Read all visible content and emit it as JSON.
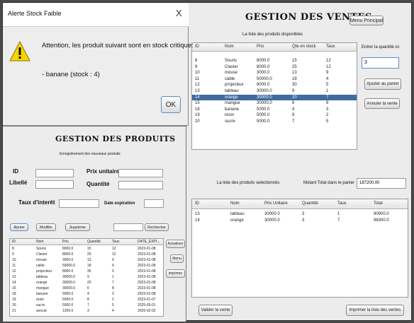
{
  "alert": {
    "title": "Alerte Stock Faible",
    "close": "X",
    "message": "Attention, les produit suivant sont en stock critique:",
    "item": "- banane (stock : 4)",
    "ok": "OK",
    "warning_color": "#f5d400"
  },
  "ventes": {
    "title": "GESTION DES VENTES",
    "menu_btn": "Menu Principal",
    "available_caption": "La liste des produits disponibles",
    "qty_label": "Entrer la quantité ici",
    "qty_value": "3",
    "add_btn": "Ajouter au panier",
    "cancel_btn": "Annuler la vente",
    "available_cols": [
      "ID",
      "Nom",
      "Prix",
      "Qte en stock",
      "Taux"
    ],
    "available_rows": [
      [
        "8",
        "Souris",
        "8000.0",
        "15",
        "12"
      ],
      [
        "9",
        "Clavier",
        "8000.0",
        "25",
        "12"
      ],
      [
        "10",
        "mouse",
        "3000.0",
        "13",
        "9"
      ],
      [
        "11",
        "cable",
        "50000.0",
        "18",
        "4"
      ],
      [
        "12",
        "projecteur",
        "8000.0",
        "30",
        "5"
      ],
      [
        "13",
        "tableau",
        "30000.0",
        "9",
        "1"
      ],
      [
        "14",
        "orange",
        "30000.0",
        "20",
        "7"
      ],
      [
        "15",
        "mangue",
        "30000.0",
        "6",
        "8"
      ],
      [
        "18",
        "banane",
        "5000.0",
        "4",
        "3"
      ],
      [
        "19",
        "resin",
        "5000.0",
        "8",
        "2"
      ],
      [
        "20",
        "sucre",
        "5000.0",
        "7",
        "5"
      ]
    ],
    "selected_row_index": 6,
    "selected_caption": "La liste des produits selectionnés",
    "total_label": "Motant Total dans le panier",
    "total_value": "187200.00",
    "selected_cols": [
      "ID",
      "Nom",
      "Prix Unitaire",
      "Quantité",
      "Taux",
      "Total"
    ],
    "selected_rows": [
      [
        "13",
        "tableau",
        "30000.0",
        "3",
        "1",
        "90900.0"
      ],
      [
        "14",
        "orange",
        "30000.0",
        "3",
        "7",
        "96300.0"
      ]
    ],
    "validate_btn": "Valider la vente",
    "print_btn": "Imprimer la liste des ventes"
  },
  "produits": {
    "title": "GESTION DES PRODUITS",
    "subtitle": "Enregistrement des nouveaux produits",
    "id_label": "ID",
    "prix_label": "Prix unitaire",
    "libelle_label": "Libellé",
    "quantite_label": "Quantité",
    "taux_label": "Taux d'interêt",
    "date_label": "Date expiration",
    "ajouter": "Ajouter",
    "modifier": "Modifier",
    "supprimer": "Supprimer",
    "rechercher": "Rechercher",
    "actualiser": "Actualiser",
    "menu": "Menu",
    "imprimer": "imprimer",
    "cols": [
      "ID",
      "Nom",
      "Prix",
      "Quantité",
      "Taux",
      "DATE_EXPI..."
    ],
    "rows": [
      [
        "8",
        "Souris",
        "8000.0",
        "15",
        "12",
        "2023-01-08"
      ],
      [
        "9",
        "Clavier",
        "8000.0",
        "25",
        "12",
        "2023-01-08"
      ],
      [
        "10",
        "mouse",
        "3000.0",
        "13",
        "9",
        "2023-01-08"
      ],
      [
        "11",
        "cable",
        "50000.0",
        "18",
        "4",
        "2023-01-08"
      ],
      [
        "12",
        "projecteur",
        "8000.0",
        "30",
        "5",
        "2023-01-08"
      ],
      [
        "13",
        "tableau",
        "30000.0",
        "9",
        "1",
        "2023-01-08"
      ],
      [
        "14",
        "orange",
        "30000.0",
        "20",
        "7",
        "2023-01-08"
      ],
      [
        "15",
        "mangue",
        "30000.0",
        "6",
        "8",
        "2023-01-08"
      ],
      [
        "18",
        "banane",
        "5000.0",
        "4",
        "3",
        "2023-01-08"
      ],
      [
        "19",
        "resin",
        "5000.0",
        "8",
        "2",
        "2023-01-07"
      ],
      [
        "20",
        "sucre",
        "5000.0",
        "7",
        "5",
        "2025-05-01"
      ],
      [
        "21",
        "avocat",
        "1200.0",
        "3",
        "4",
        "2026-02-02"
      ]
    ]
  }
}
